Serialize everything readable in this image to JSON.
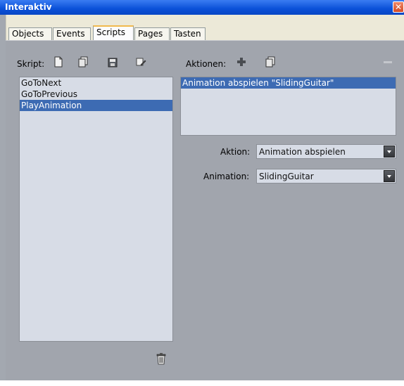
{
  "window": {
    "title": "Interaktiv",
    "close_icon": "close-icon"
  },
  "tabs": [
    {
      "label": "Objects",
      "active": false
    },
    {
      "label": "Events",
      "active": false
    },
    {
      "label": "Scripts",
      "active": true
    },
    {
      "label": "Pages",
      "active": false
    },
    {
      "label": "Tasten",
      "active": false
    }
  ],
  "scripts": {
    "label": "Skript:",
    "toolbar_icons": [
      "new-document-icon",
      "duplicate-icon",
      "save-icon",
      "edit-icon"
    ],
    "items": [
      {
        "label": "GoToNext",
        "selected": false
      },
      {
        "label": "GoToPrevious",
        "selected": false
      },
      {
        "label": "PlayAnimation",
        "selected": true
      }
    ],
    "delete_icon": "trash-icon"
  },
  "actions": {
    "label": "Aktionen:",
    "toolbar_icons": [
      "add-icon",
      "duplicate-icon",
      "remove-icon"
    ],
    "items": [
      {
        "label": "Animation abspielen  \"SlidingGuitar\"",
        "selected": true
      }
    ]
  },
  "properties": {
    "aktion": {
      "label": "Aktion:",
      "value": "Animation abspielen"
    },
    "animation": {
      "label": "Animation:",
      "value": "SlidingGuitar"
    }
  },
  "colors": {
    "titlebar": "#0a50d8",
    "panel": "#a1a5ad",
    "selection": "#3d6bb3",
    "list_bg": "#d7dce6"
  }
}
